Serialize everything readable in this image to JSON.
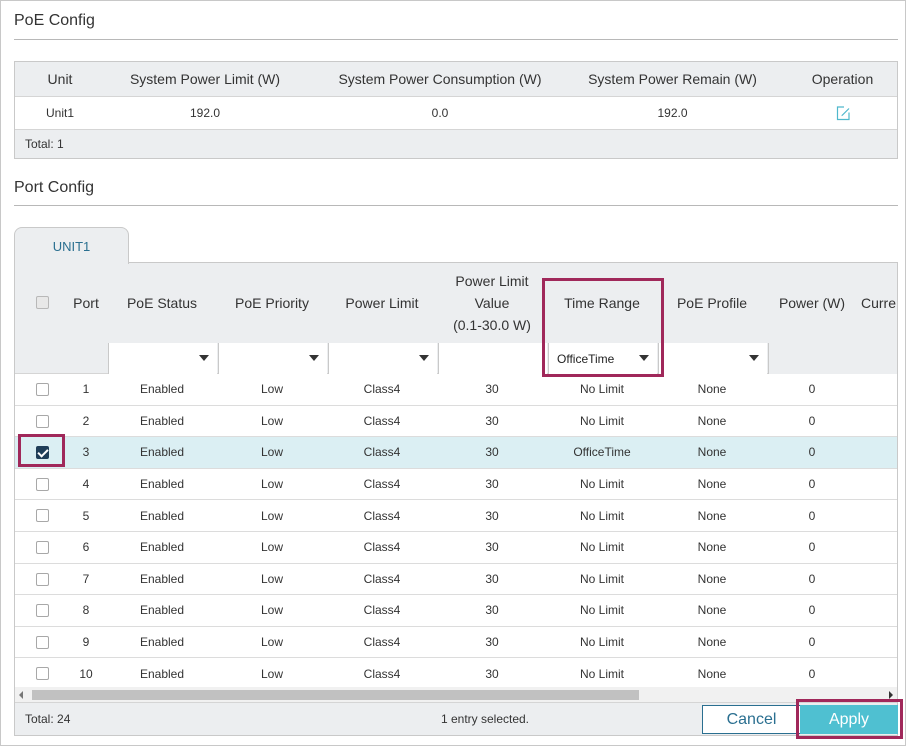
{
  "poe_config": {
    "title": "PoE Config",
    "columns": [
      "Unit",
      "System Power Limit (W)",
      "System Power Consumption (W)",
      "System Power Remain (W)",
      "Operation"
    ],
    "row": {
      "unit": "Unit1",
      "limit": "192.0",
      "consumption": "0.0",
      "remain": "192.0",
      "operation_icon": "edit-icon"
    },
    "total": "Total: 1"
  },
  "port_config": {
    "title": "Port Config",
    "tab": "UNIT1",
    "columns": {
      "port": "Port",
      "poe_status": "PoE Status",
      "poe_priority": "PoE Priority",
      "power_limit": "Power Limit",
      "power_limit_value_1": "Power Limit",
      "power_limit_value_2": "Value",
      "power_limit_value_3": "(0.1-30.0 W)",
      "time_range": "Time Range",
      "poe_profile": "PoE Profile",
      "power": "Power (W)",
      "current": "Curre"
    },
    "filters": {
      "time_range": "OfficeTime"
    },
    "rows": [
      {
        "port": "1",
        "status": "Enabled",
        "priority": "Low",
        "limit": "Class4",
        "value": "30",
        "time_range": "No Limit",
        "profile": "None",
        "power": "0",
        "checked": false
      },
      {
        "port": "2",
        "status": "Enabled",
        "priority": "Low",
        "limit": "Class4",
        "value": "30",
        "time_range": "No Limit",
        "profile": "None",
        "power": "0",
        "checked": false
      },
      {
        "port": "3",
        "status": "Enabled",
        "priority": "Low",
        "limit": "Class4",
        "value": "30",
        "time_range": "OfficeTime",
        "profile": "None",
        "power": "0",
        "checked": true
      },
      {
        "port": "4",
        "status": "Enabled",
        "priority": "Low",
        "limit": "Class4",
        "value": "30",
        "time_range": "No Limit",
        "profile": "None",
        "power": "0",
        "checked": false
      },
      {
        "port": "5",
        "status": "Enabled",
        "priority": "Low",
        "limit": "Class4",
        "value": "30",
        "time_range": "No Limit",
        "profile": "None",
        "power": "0",
        "checked": false
      },
      {
        "port": "6",
        "status": "Enabled",
        "priority": "Low",
        "limit": "Class4",
        "value": "30",
        "time_range": "No Limit",
        "profile": "None",
        "power": "0",
        "checked": false
      },
      {
        "port": "7",
        "status": "Enabled",
        "priority": "Low",
        "limit": "Class4",
        "value": "30",
        "time_range": "No Limit",
        "profile": "None",
        "power": "0",
        "checked": false
      },
      {
        "port": "8",
        "status": "Enabled",
        "priority": "Low",
        "limit": "Class4",
        "value": "30",
        "time_range": "No Limit",
        "profile": "None",
        "power": "0",
        "checked": false
      },
      {
        "port": "9",
        "status": "Enabled",
        "priority": "Low",
        "limit": "Class4",
        "value": "30",
        "time_range": "No Limit",
        "profile": "None",
        "power": "0",
        "checked": false
      },
      {
        "port": "10",
        "status": "Enabled",
        "priority": "Low",
        "limit": "Class4",
        "value": "30",
        "time_range": "No Limit",
        "profile": "None",
        "power": "0",
        "checked": false
      }
    ],
    "total": "Total: 24",
    "selection": "1 entry selected."
  },
  "buttons": {
    "cancel": "Cancel",
    "apply": "Apply"
  },
  "colors": {
    "accent": "#4fc0d1",
    "highlight": "#a0285a",
    "selected_row": "#dbeff3",
    "header_bg": "#eceef0"
  }
}
